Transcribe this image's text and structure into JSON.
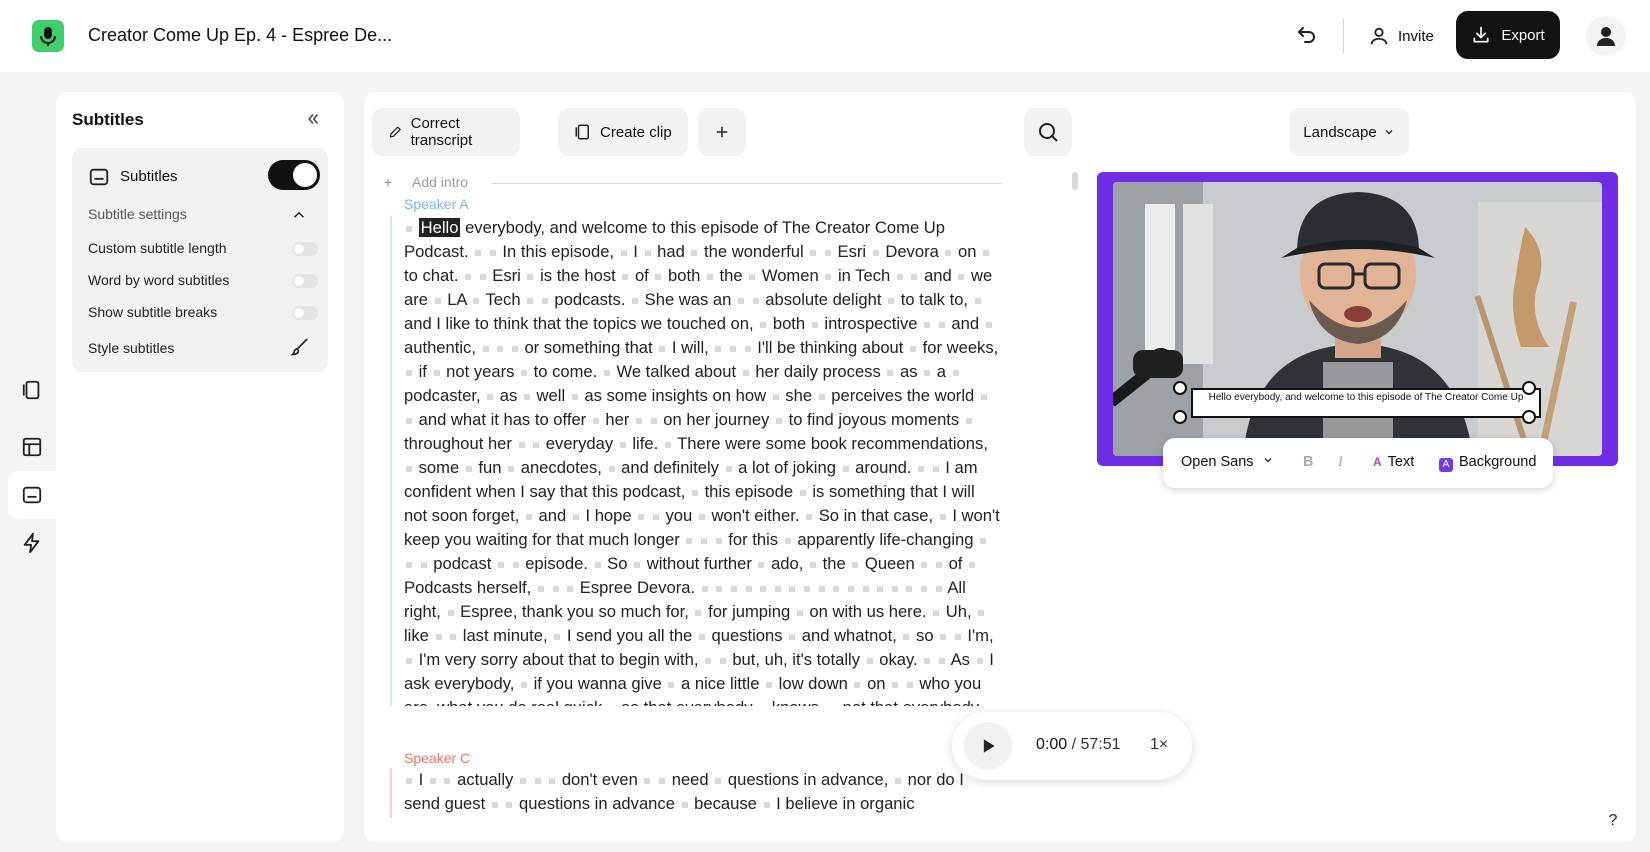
{
  "header": {
    "title": "Creator Come Up Ep. 4 - Espree De...",
    "invite_label": "Invite",
    "export_label": "Export"
  },
  "rail": [
    {
      "icon": "clip-icon"
    },
    {
      "icon": "layout-icon"
    },
    {
      "icon": "subtitles-icon",
      "selected": true
    },
    {
      "icon": "lightning-icon"
    }
  ],
  "subtitles_panel": {
    "title": "Subtitles",
    "toggle_label": "Subtitles",
    "toggle_on": true,
    "settings_label": "Subtitle settings",
    "options": [
      {
        "label": "Custom subtitle length",
        "on": false
      },
      {
        "label": "Word by word subtitles",
        "on": false
      },
      {
        "label": "Show subtitle breaks",
        "on": false
      }
    ],
    "style_label": "Style subtitles"
  },
  "toolbar": {
    "correct_label": "Correct transcript",
    "clip_label": "Create clip",
    "orientation_label": "Landscape"
  },
  "transcript": {
    "add_intro": "Add intro",
    "speaker_a": {
      "name": "Speaker A",
      "color": "#7ab6e3",
      "highlight_word": "Hello",
      "text": "everybody, and welcome to this episode of The Creator Come Up Podcast. ▪ ▪ In this episode, ▪ I ▪ had ▪ the wonderful ▪ ▪ Esri ▪ Devora ▪ on ▪ to chat. ▪ ▪ Esri ▪ is the host ▪ of ▪ both ▪ the ▪ Women ▪ in Tech ▪ ▪ and ▪ we are ▪ LA ▪ Tech ▪ ▪ podcasts. ▪ She was an ▪ ▪ absolute delight ▪ to talk to, ▪ and I like to think that the topics we touched on, ▪ both ▪ introspective ▪ ▪ and ▪ authentic, ▪ ▪ ▪ or something that ▪ I will, ▪ ▪ ▪ I'll be thinking about ▪ for weeks, ▪ if ▪ not years ▪ to come. ▪ We talked about ▪ her daily process ▪ as ▪ a ▪ podcaster, ▪ as ▪ well ▪ as some insights on how ▪ she ▪ perceives the world ▪ ▪ and what it has to offer ▪ her ▪ ▪ on her journey ▪ to find joyous moments ▪ throughout her ▪ ▪ everyday ▪ life. ▪ There were some book recommendations, ▪ some ▪ fun ▪ anecdotes, ▪ and definitely ▪ a lot of joking ▪ around. ▪ ▪ I am confident when I say that this podcast, ▪ this episode ▪ is something that I will not soon forget, ▪ and ▪ I hope ▪ ▪ you ▪ won't either. ▪ So in that case, ▪ I won't keep you waiting for that much longer ▪ ▪ ▪ for this ▪ apparently life-changing ▪ ▪ ▪ podcast ▪ ▪ episode. ▪ So ▪ without further ▪ ado, ▪ the ▪ Queen ▪ ▪ of ▪ Podcasts herself, ▪ ▪ ▪ Espree Devora. ▪ ▪ ▪ ▪ ▪ ▪ ▪ ▪ ▪ ▪ ▪ ▪ ▪ ▪ ▪ ▪ ▪ All right, ▪ Espree, thank you so much for, ▪ for jumping ▪ on with us here. ▪ Uh, ▪ like ▪ ▪ last minute, ▪ I send you all the ▪ questions ▪ and whatnot, ▪ so ▪ ▪ I'm, ▪ I'm very sorry about that to begin with, ▪ ▪ but, uh, it's totally ▪ okay. ▪ ▪ As ▪ I ask everybody, ▪ if you wanna give ▪ a nice little ▪ low down ▪ on ▪ ▪ who you are, what you do real quick ▪ so that everybody ▪ knows, ▪ not that everybody wouldn't know who ▪ you are, ▪ but you know, ▪ Oh, ▪ I don't assume anybody would know ▪ ▪ ▪ But ▪ ▪ in regards to the ▪ question, ▪ it's ▪ interesting."
    },
    "speaker_c": {
      "name": "Speaker C",
      "color": "#e8766a",
      "text": "▪ I ▪ ▪ actually ▪ ▪ ▪ don't even ▪ ▪ need ▪ questions in advance, ▪ nor do I send guest ▪ ▪ questions in advance ▪ because ▪ I believe in organic conversations. ▪ ▪ All right. ▪"
    }
  },
  "video": {
    "frame_color": "#6f2de6",
    "caption_text": "Hello everybody, and welcome to this episode of The Creator Come Up"
  },
  "caption_toolbar": {
    "font": "Open Sans",
    "bold_label": "B",
    "italic_label": "I",
    "text_label": "Text",
    "background_label": "Background"
  },
  "player": {
    "current": "0:00",
    "separator": "/",
    "total": "57:51",
    "rate": "1×"
  },
  "help_label": "?"
}
